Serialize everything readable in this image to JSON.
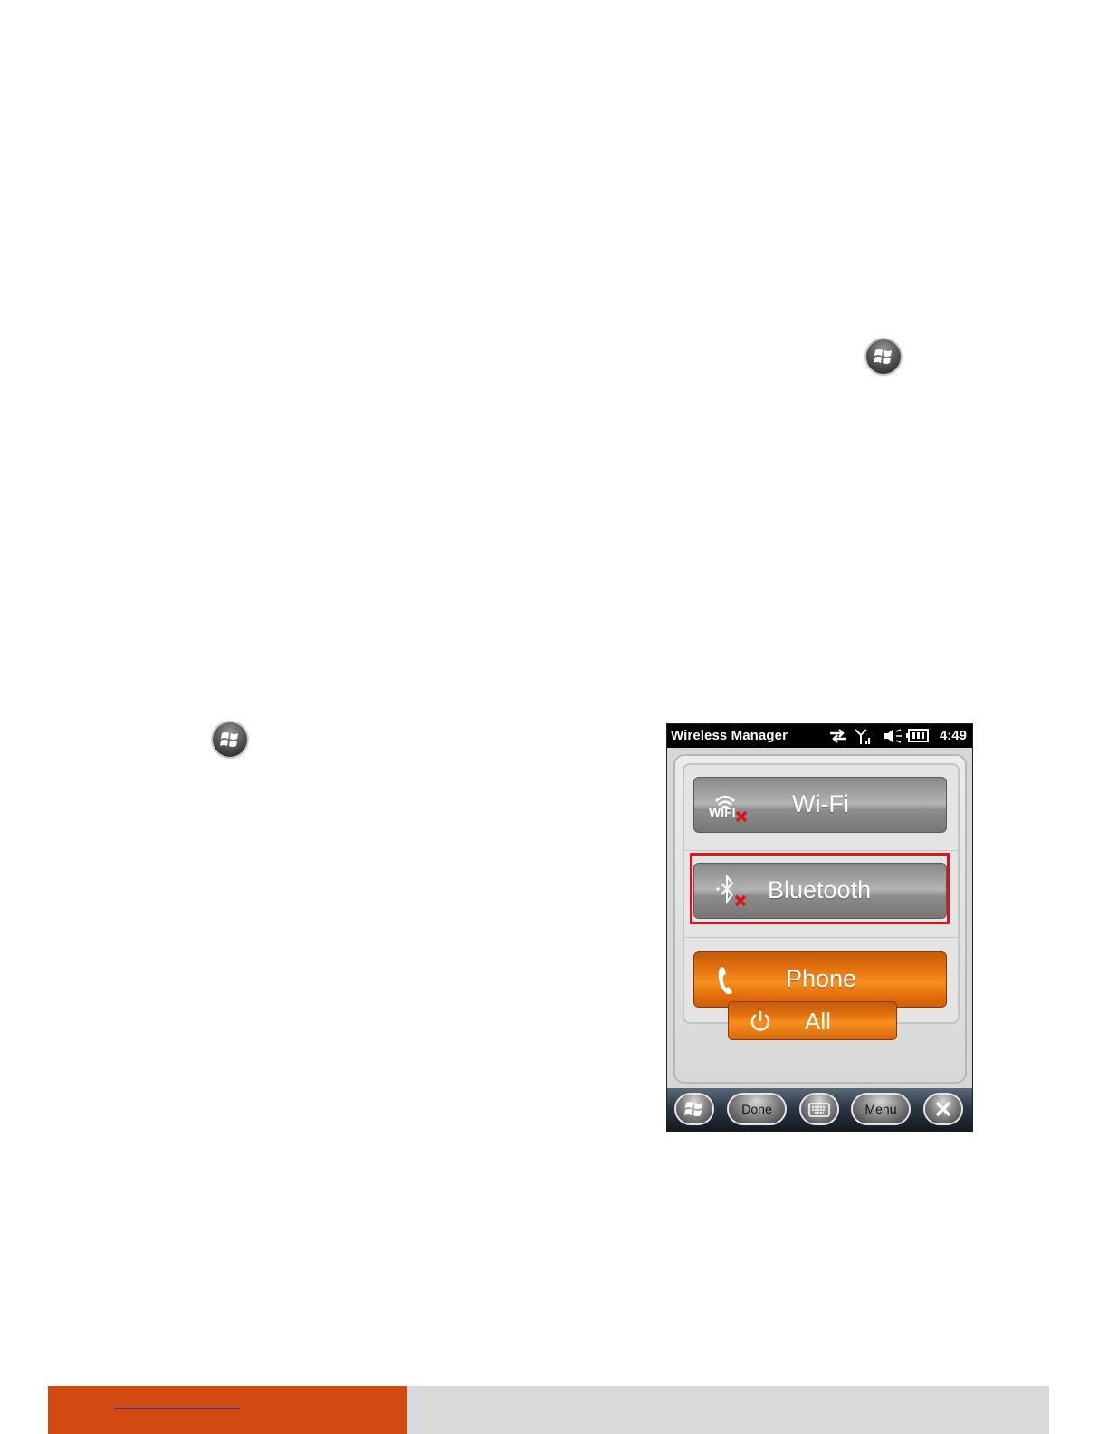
{
  "device": {
    "statusbar": {
      "title": "Wireless Manager",
      "time": "4:49"
    },
    "buttons": {
      "wifi": {
        "label": "Wi-Fi",
        "icon_text": "WIFI",
        "state": "off"
      },
      "bluetooth": {
        "label": "Bluetooth",
        "state": "off"
      },
      "phone": {
        "label": "Phone",
        "state": "on"
      },
      "all": {
        "label": "All"
      }
    },
    "taskbar": {
      "done_label": "Done",
      "menu_label": "Menu"
    }
  },
  "colors": {
    "accent_orange": "#f18a1a",
    "highlight_red": "#e0101c",
    "footer_orange": "#d24a12",
    "footer_gray": "#d9d9d9"
  }
}
